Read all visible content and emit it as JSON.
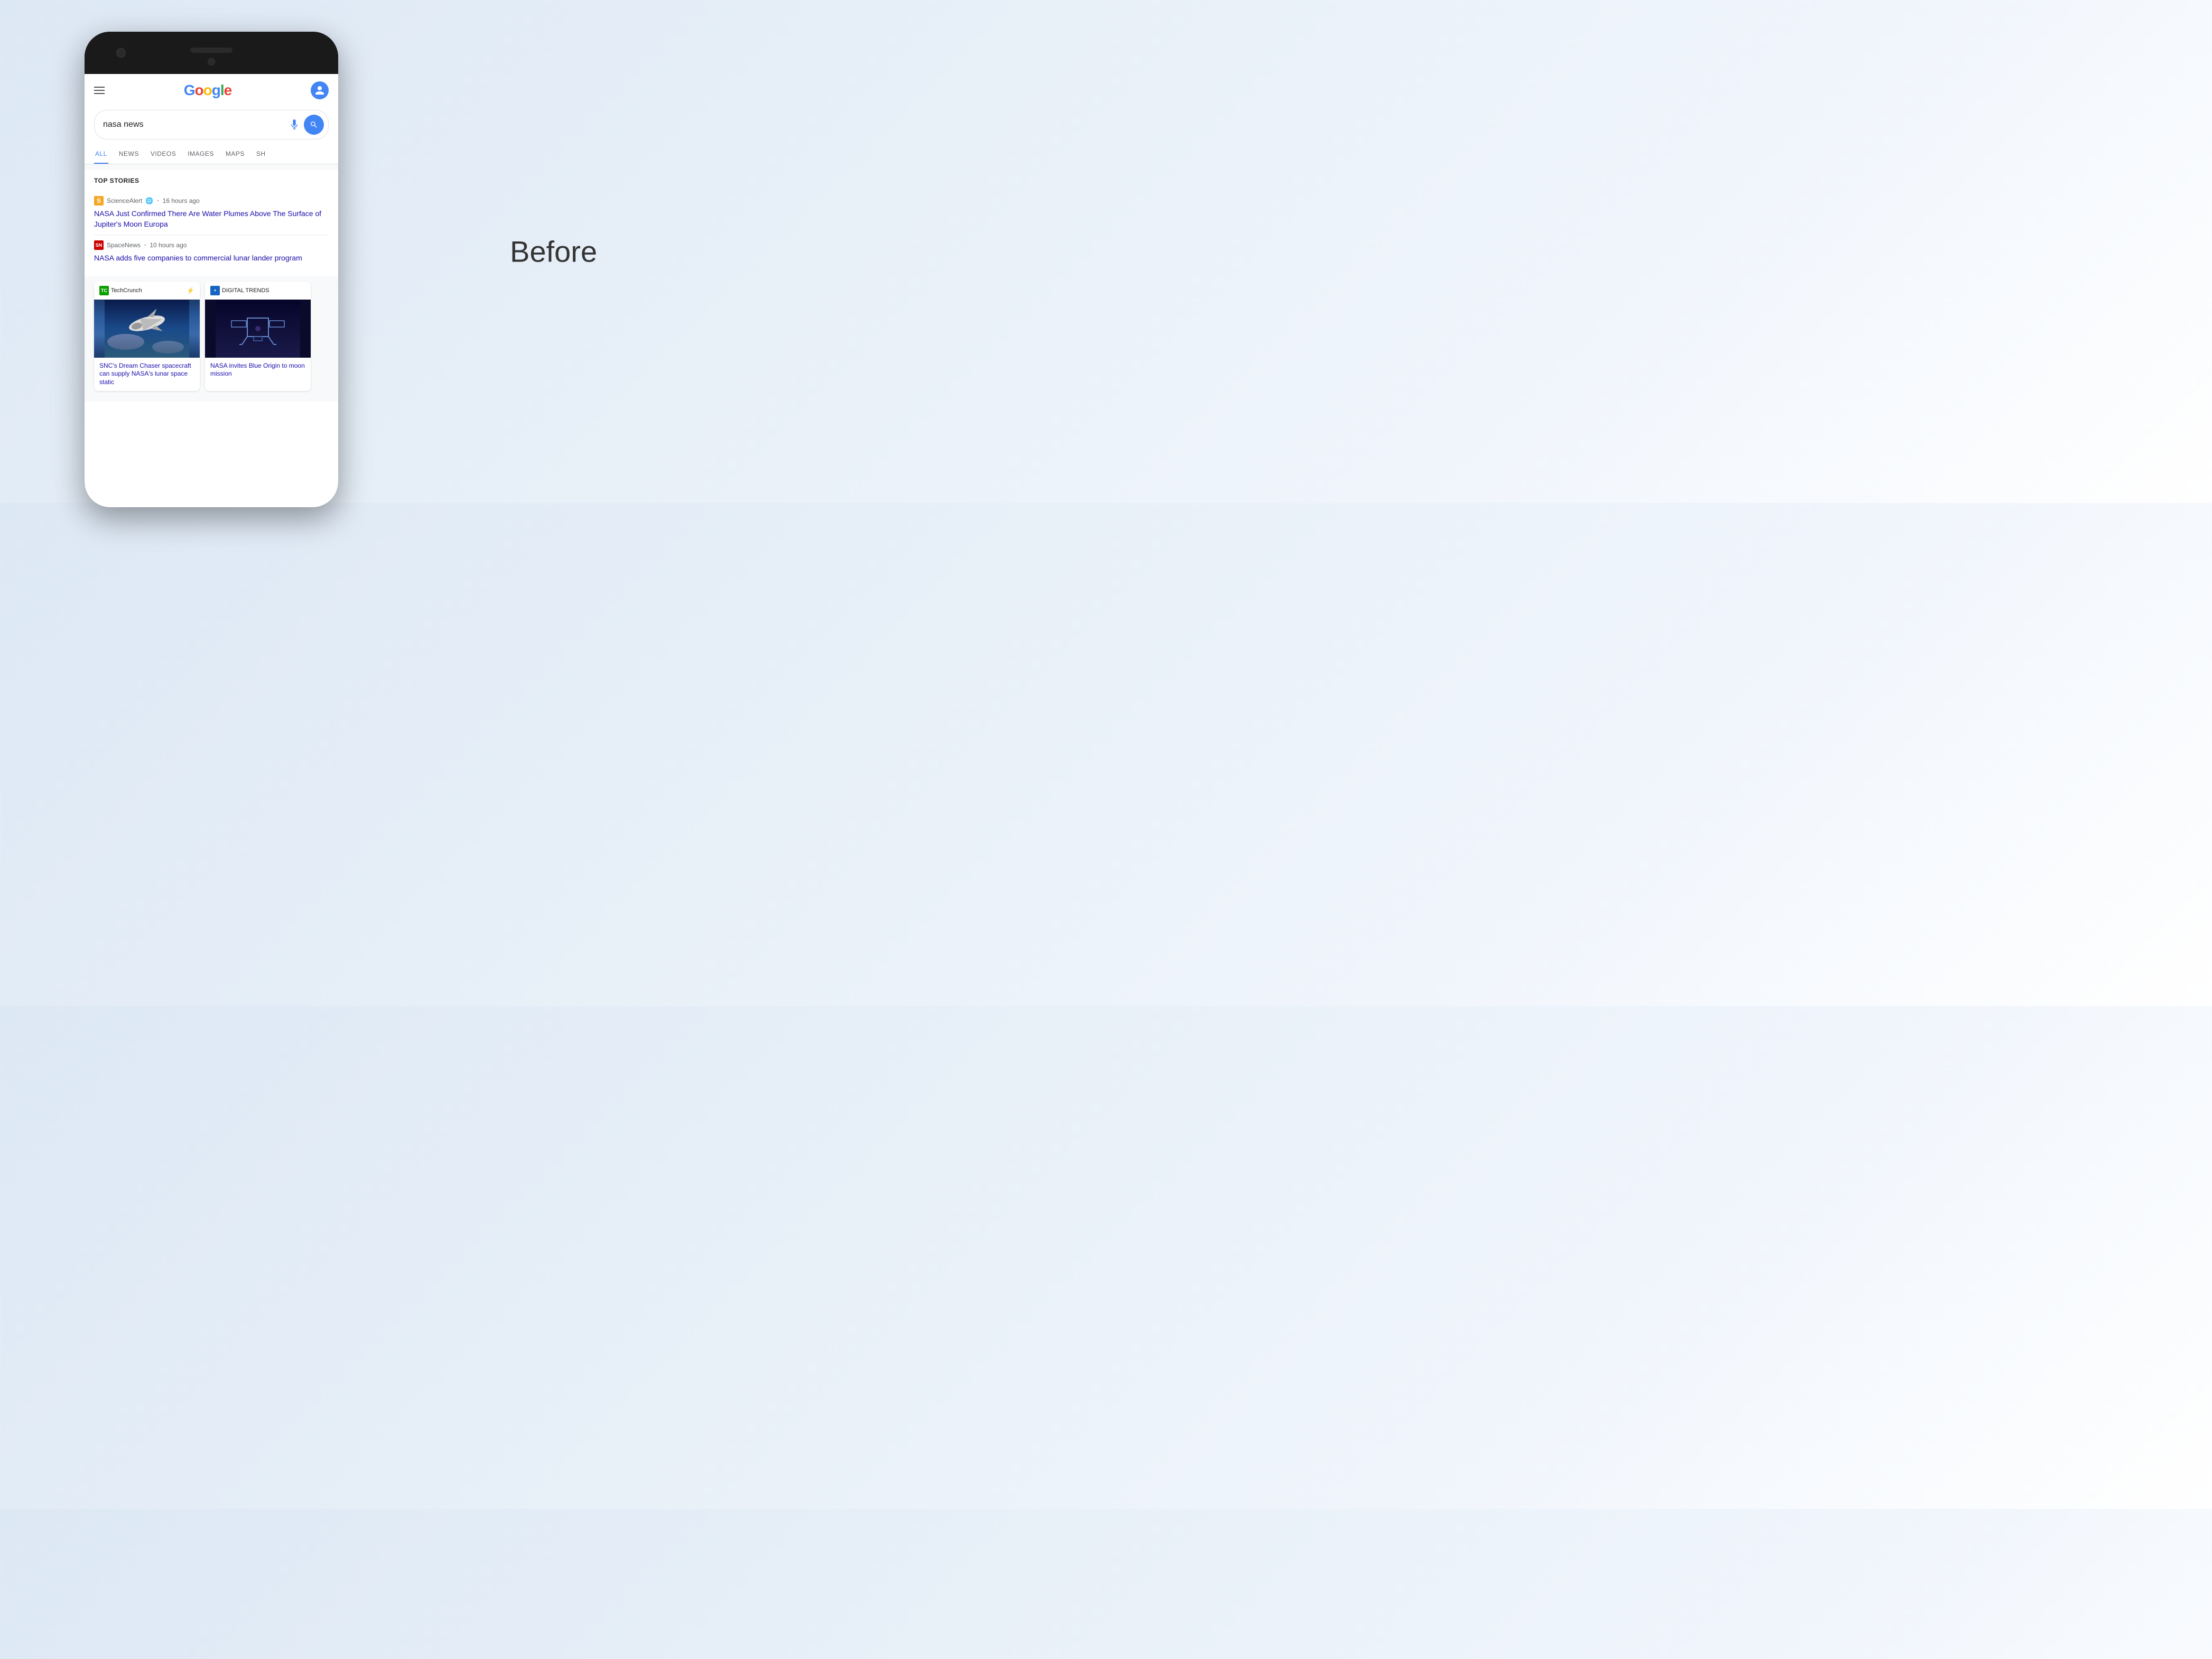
{
  "background": {
    "color": "#dde8f5"
  },
  "before_label": "Before",
  "phone": {
    "header": {
      "menu_label": "Menu",
      "google_logo": "Google",
      "google_letters": [
        "G",
        "o",
        "o",
        "g",
        "l",
        "e"
      ],
      "user_icon": "person"
    },
    "search": {
      "query": "nasa news",
      "placeholder": "nasa news",
      "mic_label": "Voice search",
      "search_button_label": "Search"
    },
    "nav_tabs": [
      {
        "label": "ALL",
        "active": true
      },
      {
        "label": "NEWS",
        "active": false
      },
      {
        "label": "VIDEOS",
        "active": false
      },
      {
        "label": "IMAGES",
        "active": false
      },
      {
        "label": "MAPS",
        "active": false
      },
      {
        "label": "SH...",
        "active": false
      }
    ],
    "top_stories_section": {
      "title": "TOP STORIES",
      "stories": [
        {
          "source_name": "ScienceAlert",
          "source_icon_letter": "S",
          "source_icon_bg": "#f5a623",
          "time_ago": "16 hours ago",
          "title": "NASA Just Confirmed There Are Water Plumes Above The Surface of Jupiter's Moon Europa",
          "has_globe": true
        },
        {
          "source_name": "SpaceNews",
          "source_icon_text": "SN",
          "source_icon_bg": "#cc0000",
          "time_ago": "10 hours ago",
          "title": "NASA adds five companies to commercial lunar lander program",
          "has_globe": false
        }
      ]
    },
    "news_cards": [
      {
        "source_name": "TechCrunch",
        "source_icon_text": "TC",
        "source_icon_bg": "#0a9e00",
        "has_lightning": true,
        "image_type": "shuttle",
        "title": "SNC's Dream Chaser spacecraft can supply NASA's lunar space static",
        "subtitle": ""
      },
      {
        "source_name": "DIGITAL TRENDS",
        "source_icon_text": "+",
        "source_icon_bg": "#1565c0",
        "has_lightning": false,
        "image_type": "lunar-lander",
        "title": "NASA invites Blue Origin to moon mission",
        "subtitle": ""
      }
    ]
  }
}
